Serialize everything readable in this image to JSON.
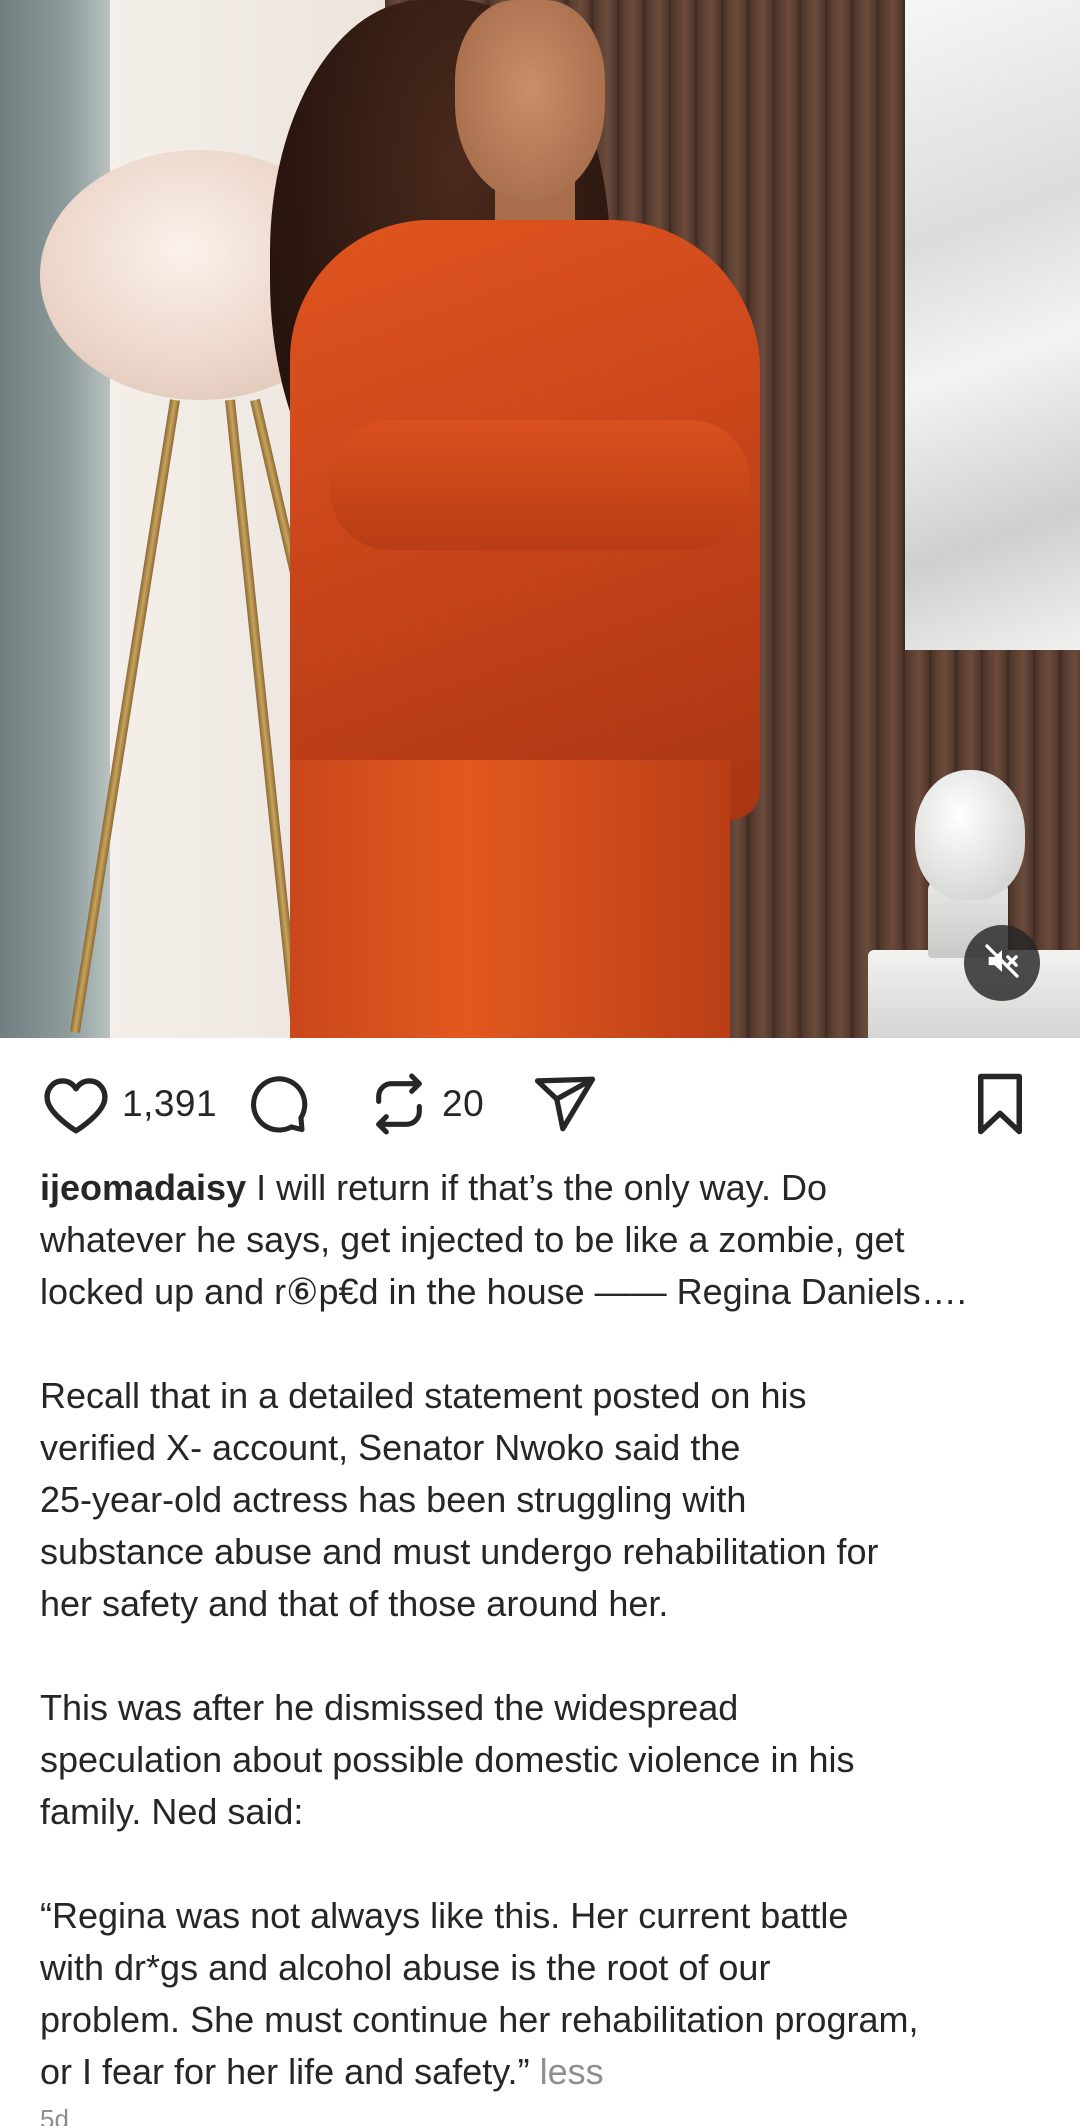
{
  "post": {
    "image_alt": "Woman in orange suit standing in a room",
    "mute_icon": "speaker-muted-icon",
    "likes": "1,391",
    "reposts": "20",
    "icons": {
      "like": "heart-icon",
      "comment": "speech-bubble-icon",
      "repost": "repost-arrows-icon",
      "share": "paper-plane-icon",
      "save": "bookmark-icon"
    },
    "caption": {
      "username": "ijeomadaisy",
      "first_line": "I will return if that’s the only way. Do",
      "line2": "whatever he says, get injected to be like a zombie, get",
      "line3": "locked up and r⑥p€d in the house —— Regina Daniels….",
      "para2": "Recall that in a detailed statement posted on his\nverified X- account, Senator Nwoko said the\n25-year-old actress has been struggling with\nsubstance abuse and must undergo rehabilitation for\nher safety and that of those around her.",
      "para3": "This was after he dismissed the widespread\nspeculation about possible domestic violence in his\nfamily. Ned said:",
      "para4": "“Regina was not always like this. Her current battle\nwith dr*gs and alcohol abuse is the root of our\nproblem. She must continue her rehabilitation program,\nor I fear for her life and safety.”",
      "less_label": "less"
    },
    "timestamp": "5d"
  }
}
